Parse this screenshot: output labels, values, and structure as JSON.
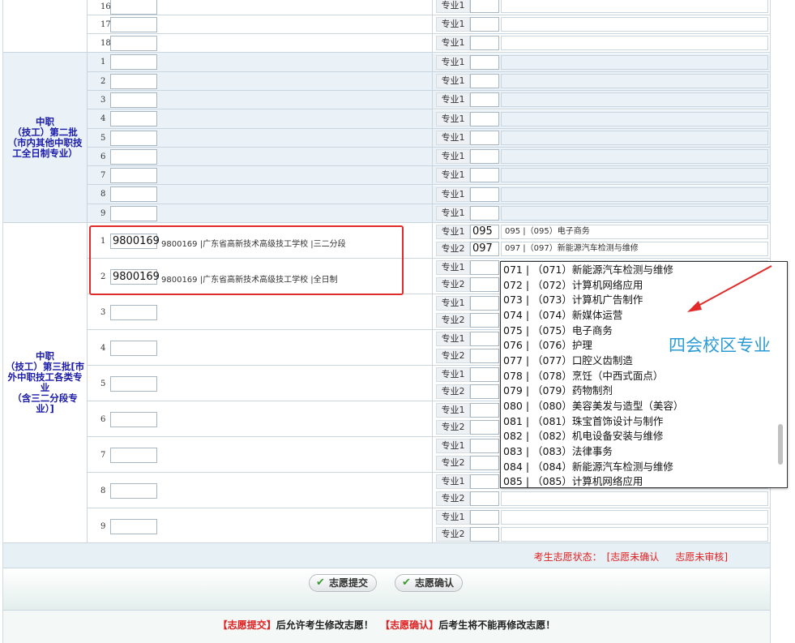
{
  "groups": [
    {
      "label": [
        "中职",
        "（技工）第二批",
        "（市内其他中职技",
        "工全日制专业）"
      ]
    },
    {
      "label": [
        "中职",
        "（技工）第三批[市",
        "外中职技工各类专",
        "业",
        "（含三二分段专",
        "业）]"
      ]
    }
  ],
  "major_label_1": "专业1",
  "major_label_2": "专业2",
  "top_rows": [
    {
      "idx": "16"
    },
    {
      "idx": "17"
    },
    {
      "idx": "18"
    }
  ],
  "batch2_rows": [
    {
      "idx": "1"
    },
    {
      "idx": "2"
    },
    {
      "idx": "3"
    },
    {
      "idx": "4"
    },
    {
      "idx": "5"
    },
    {
      "idx": "6"
    },
    {
      "idx": "7"
    },
    {
      "idx": "8"
    },
    {
      "idx": "9"
    }
  ],
  "batch3_rows": [
    {
      "idx": "1",
      "code": "9800169",
      "desc": "9800169 |广东省高新技术高级技工学校 |三二分段",
      "m1_code": "095",
      "m1_desc": "095 |（095）电子商务",
      "m2_code": "097",
      "m2_desc": "097 |（097）新能源汽车检测与维修"
    },
    {
      "idx": "2",
      "code": "9800169",
      "desc": "9800169 |广东省高新技术高级技工学校 |全日制",
      "m1_code": "",
      "m1_desc": "",
      "m2_code": "",
      "m2_desc": ""
    },
    {
      "idx": "3"
    },
    {
      "idx": "4"
    },
    {
      "idx": "5"
    },
    {
      "idx": "6"
    },
    {
      "idx": "7"
    },
    {
      "idx": "8"
    },
    {
      "idx": "9"
    }
  ],
  "dropdown_items": [
    "071 | （071）新能源汽车检测与维修",
    "072 | （072）计算机网络应用",
    "073 | （073）计算机广告制作",
    "074 | （074）新媒体运营",
    "075 | （075）电子商务",
    "076 | （076）护理",
    "077 | （077）口腔义齿制造",
    "078 | （078）烹饪（中西式面点）",
    "079 | （079）药物制剂",
    "080 | （080）美容美发与造型（美容）",
    "081 | （081）珠宝首饰设计与制作",
    "082 | （082）机电设备安装与维修",
    "083 | （083）法律事务",
    "084 | （084）新能源汽车检测与维修",
    "085 | （085）计算机网络应用"
  ],
  "campus_note": "四会校区专业",
  "status": {
    "label": "考生志愿状态：",
    "state1": "[志愿未确认",
    "state2": "志愿未审核]"
  },
  "buttons": {
    "submit": "志愿提交",
    "confirm": "志愿确认"
  },
  "notice": {
    "part1": "【志愿提交】",
    "part2": "后允许考生修改志愿！",
    "part3": "【志愿确认】",
    "part4": "后考生将不能再修改志愿！"
  },
  "colors": {
    "accent_red": "#e02020",
    "group_text": "#1a1aa8",
    "note_blue": "#2b9bd6"
  }
}
